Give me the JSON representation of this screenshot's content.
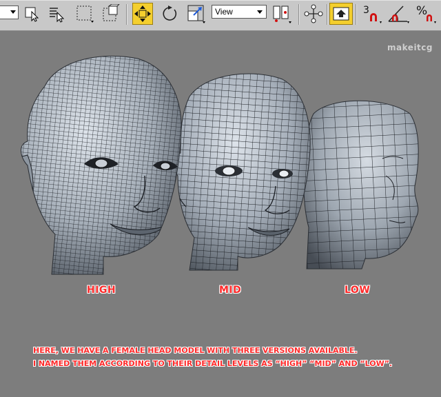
{
  "toolbar": {
    "view_dropdown": "View",
    "snap_3": "3",
    "percent": "%",
    "percent_sub": "n",
    "colors": {
      "bg": "#c8c8c8",
      "active": "#f4cf2e",
      "magnet": "#d01010"
    },
    "tools": [
      "select-object-icon",
      "select-by-name-icon",
      "rect-selection-icon",
      "window-crossing-icon",
      "select-and-move-icon",
      "select-and-rotate-icon",
      "select-and-scale-icon",
      "pivot-point-icon",
      "manipulate-icon",
      "keyboard-shortcut-override-icon",
      "snap-toggle-icon",
      "angle-snap-icon",
      "percent-snap-icon"
    ]
  },
  "watermark": "makeitcg",
  "labels": {
    "high": "HIGH",
    "mid": "MID",
    "low": "LOW"
  },
  "caption": {
    "line1": "HERE, WE HAVE A FEMALE HEAD MODEL WITH THREE VERSIONS AVAILABLE.",
    "line2": "I NAMED THEM ACCORDING TO THEIR DETAIL LEVELS AS “HIGH” “MID” AND “LOW”."
  },
  "colors": {
    "viewport": "#7d7d7d",
    "label": "#ff2a2a",
    "mesh": "#9aa3ad",
    "wire": "#1a1d22"
  }
}
